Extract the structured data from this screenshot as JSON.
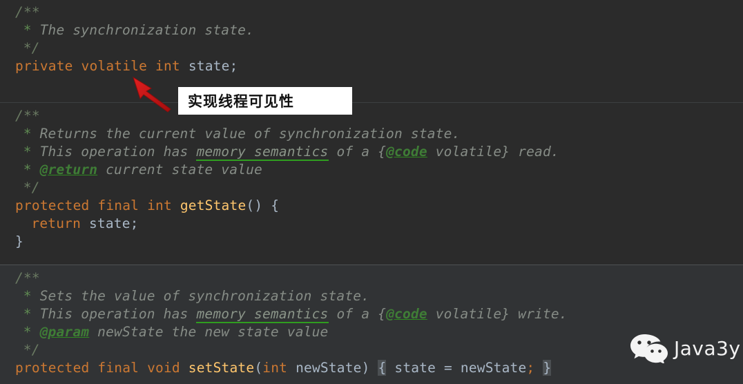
{
  "editor": {
    "background_color": "#2b2b2b",
    "highlight_background_color": "#313335",
    "theme": "Darcula"
  },
  "colors": {
    "keyword": "#cc7832",
    "identifier": "#a9b7c6",
    "method": "#ffc66d",
    "javadoc_text": "#868c86",
    "javadoc_tag": "#3f7d36",
    "comment_marker": "#5f8a52",
    "annotation_box_background": "#ffffff",
    "annotation_arrow": "#cc1111"
  },
  "panes": {
    "pane_a": {
      "lines": [
        {
          "indent": 0,
          "tokens": [
            {
              "t": "/**",
              "k": "comment"
            }
          ]
        },
        {
          "indent": 1,
          "tokens": [
            {
              "t": "* ",
              "k": "star"
            },
            {
              "t": "The synchronization state.",
              "k": "doctext"
            }
          ]
        },
        {
          "indent": 1,
          "tokens": [
            {
              "t": "*/",
              "k": "comment"
            }
          ]
        },
        {
          "indent": 0,
          "tokens": [
            {
              "t": "private",
              "k": "keyword"
            },
            {
              "t": " ",
              "k": "punct"
            },
            {
              "t": "volatile",
              "k": "keyword"
            },
            {
              "t": " ",
              "k": "punct"
            },
            {
              "t": "int",
              "k": "keyword"
            },
            {
              "t": " ",
              "k": "punct"
            },
            {
              "t": "state;",
              "k": "ident"
            }
          ]
        }
      ]
    },
    "pane_b": {
      "lines": [
        {
          "indent": 0,
          "tokens": [
            {
              "t": "/**",
              "k": "comment"
            }
          ]
        },
        {
          "indent": 1,
          "tokens": [
            {
              "t": "* ",
              "k": "star"
            },
            {
              "t": "Returns the current value of synchronization state.",
              "k": "doctext"
            }
          ]
        },
        {
          "indent": 1,
          "tokens": [
            {
              "t": "* ",
              "k": "star"
            },
            {
              "t": "This operation has ",
              "k": "doctext"
            },
            {
              "t": "memory semantics",
              "k": "link"
            },
            {
              "t": " of a {",
              "k": "doctext"
            },
            {
              "t": "@code",
              "k": "tag"
            },
            {
              "t": " volatile} read.",
              "k": "doctext"
            }
          ]
        },
        {
          "indent": 1,
          "tokens": [
            {
              "t": "* ",
              "k": "star"
            },
            {
              "t": "@return",
              "k": "tag"
            },
            {
              "t": " current state value",
              "k": "doctext"
            }
          ]
        },
        {
          "indent": 1,
          "tokens": [
            {
              "t": "*/",
              "k": "comment"
            }
          ]
        },
        {
          "indent": 0,
          "tokens": [
            {
              "t": "protected",
              "k": "keyword"
            },
            {
              "t": " ",
              "k": "punct"
            },
            {
              "t": "final",
              "k": "keyword"
            },
            {
              "t": " ",
              "k": "punct"
            },
            {
              "t": "int",
              "k": "keyword"
            },
            {
              "t": " ",
              "k": "punct"
            },
            {
              "t": "getState",
              "k": "method"
            },
            {
              "t": "() {",
              "k": "punct"
            }
          ]
        },
        {
          "indent": 2,
          "tokens": [
            {
              "t": "return",
              "k": "keyword"
            },
            {
              "t": " ",
              "k": "punct"
            },
            {
              "t": "state;",
              "k": "ident"
            }
          ]
        },
        {
          "indent": 0,
          "tokens": [
            {
              "t": "}",
              "k": "punct"
            }
          ]
        }
      ]
    },
    "pane_c": {
      "lines": [
        {
          "indent": 0,
          "tokens": [
            {
              "t": "/**",
              "k": "comment"
            }
          ]
        },
        {
          "indent": 1,
          "tokens": [
            {
              "t": "* ",
              "k": "star"
            },
            {
              "t": "Sets the value of synchronization state.",
              "k": "doctext"
            }
          ]
        },
        {
          "indent": 1,
          "tokens": [
            {
              "t": "* ",
              "k": "star"
            },
            {
              "t": "This operation has ",
              "k": "doctext"
            },
            {
              "t": "memory semantics",
              "k": "link"
            },
            {
              "t": " of a {",
              "k": "doctext"
            },
            {
              "t": "@code",
              "k": "tag"
            },
            {
              "t": " volatile} write.",
              "k": "doctext"
            }
          ]
        },
        {
          "indent": 1,
          "tokens": [
            {
              "t": "* ",
              "k": "star"
            },
            {
              "t": "@param",
              "k": "tag"
            },
            {
              "t": " newState the new state value",
              "k": "doctext"
            }
          ]
        },
        {
          "indent": 1,
          "tokens": [
            {
              "t": "*/",
              "k": "comment"
            }
          ]
        },
        {
          "indent": 0,
          "tokens": [
            {
              "t": "protected",
              "k": "keyword"
            },
            {
              "t": " ",
              "k": "punct"
            },
            {
              "t": "final",
              "k": "keyword"
            },
            {
              "t": " ",
              "k": "punct"
            },
            {
              "t": "void",
              "k": "keyword"
            },
            {
              "t": " ",
              "k": "punct"
            },
            {
              "t": "setState",
              "k": "method"
            },
            {
              "t": "(",
              "k": "punct"
            },
            {
              "t": "int",
              "k": "keyword"
            },
            {
              "t": " ",
              "k": "punct"
            },
            {
              "t": "newState",
              "k": "ident"
            },
            {
              "t": ") ",
              "k": "punct"
            },
            {
              "t": "{",
              "k": "brace-hl"
            },
            {
              "t": " state = newState",
              "k": "ident"
            },
            {
              "t": ";",
              "k": "keyword"
            },
            {
              "t": " ",
              "k": "punct"
            },
            {
              "t": "}",
              "k": "brace-hl"
            }
          ]
        }
      ]
    }
  },
  "annotation": {
    "label": "实现线程可见性",
    "arrow_points_to": "volatile"
  },
  "watermark": {
    "icon": "wechat-icon",
    "text": "Java3y"
  }
}
